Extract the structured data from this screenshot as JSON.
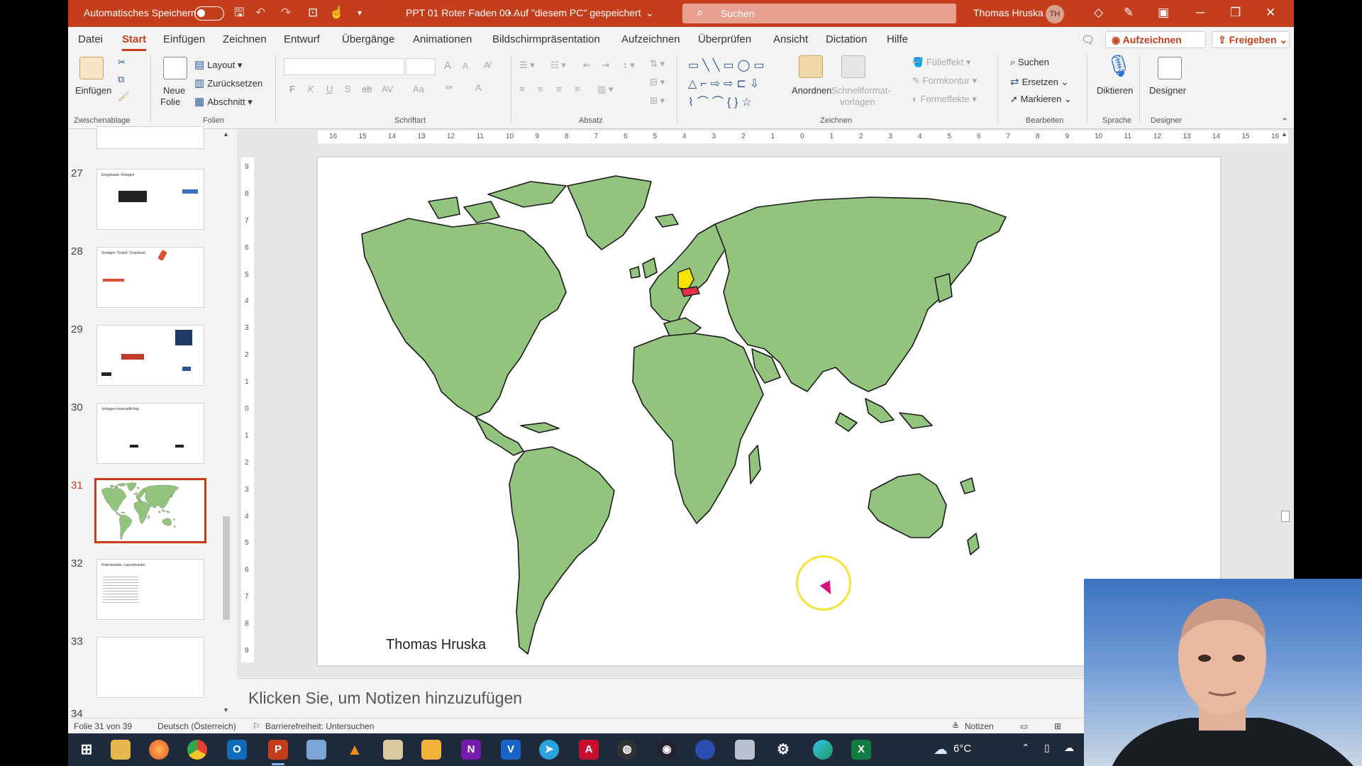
{
  "titlebar": {
    "autosave_label": "Automatisches Speichern",
    "doc_title": "PPT 01 Roter Faden 00...",
    "save_location": "• Auf \"diesem PC\" gespeichert",
    "search_placeholder": "Suchen",
    "user_name": "Thomas Hruska",
    "user_initials": "TH"
  },
  "menu": {
    "tabs": [
      "Datei",
      "Start",
      "Einfügen",
      "Zeichnen",
      "Entwurf",
      "Übergänge",
      "Animationen",
      "Bildschirmpräsentation",
      "Aufzeichnen",
      "Überprüfen",
      "Ansicht",
      "Dictation",
      "Hilfe"
    ],
    "active_tab": "Start",
    "record_label": "Aufzeichnen",
    "share_label": "Freigeben"
  },
  "ribbon": {
    "clipboard": {
      "paste": "Einfügen",
      "label": "Zwischenablage"
    },
    "slides": {
      "new_slide_1": "Neue",
      "new_slide_2": "Folie",
      "layout": "Layout",
      "reset": "Zurücksetzen",
      "section": "Abschnitt",
      "label": "Folien"
    },
    "font": {
      "label": "Schriftart",
      "bold": "F",
      "italic": "K",
      "underline": "U",
      "shadow": "S",
      "strike": "ab",
      "spacing": "AV",
      "case": "Aa",
      "grow": "A",
      "shrink": "A"
    },
    "paragraph": {
      "label": "Absatz"
    },
    "drawing": {
      "arrange": "Anordnen",
      "quickstyles_1": "Schnellformat-",
      "quickstyles_2": "vorlagen",
      "fill": "Fülleffekt",
      "outline": "Formkontur",
      "effects": "Formeffekte",
      "label": "Zeichnen"
    },
    "editing": {
      "find": "Suchen",
      "replace": "Ersetzen",
      "select": "Markieren",
      "label": "Bearbeiten"
    },
    "voice": {
      "dictate": "Diktieren",
      "label": "Sprache"
    },
    "designer": {
      "designer": "Designer",
      "label": "Designer"
    }
  },
  "thumbnails": [
    {
      "num": "27",
      "title": "Eingebaute Vorlagen"
    },
    {
      "num": "28",
      "title": "Vorlagen \"Gratis\" Download"
    },
    {
      "num": "29",
      "title": ""
    },
    {
      "num": "30",
      "title": "Vorlagen kostenpflichtig"
    },
    {
      "num": "31",
      "title": "",
      "selected": true
    },
    {
      "num": "32",
      "title": "Folienmaster, Layoutmaster"
    },
    {
      "num": "33",
      "title": ""
    },
    {
      "num": "34",
      "title": ""
    }
  ],
  "ruler": {
    "h": [
      "16",
      "15",
      "14",
      "13",
      "12",
      "11",
      "10",
      "9",
      "8",
      "7",
      "6",
      "5",
      "4",
      "3",
      "2",
      "1",
      "0",
      "1",
      "2",
      "3",
      "4",
      "5",
      "6",
      "7",
      "8",
      "9",
      "10",
      "11",
      "12",
      "13",
      "14",
      "15",
      "16"
    ],
    "v": [
      "9",
      "8",
      "7",
      "6",
      "5",
      "4",
      "3",
      "2",
      "1",
      "0",
      "1",
      "2",
      "3",
      "4",
      "5",
      "6",
      "7",
      "8",
      "9"
    ]
  },
  "slide": {
    "author": "Thomas Hruska",
    "map_land_color": "#93c47d",
    "highlight_germany": "#f9e400",
    "highlight_austria": "#e0304a"
  },
  "notes_placeholder": "Klicken Sie, um Notizen hinzuzufügen",
  "status": {
    "slide_count": "Folie 31 von 39",
    "language": "Deutsch (Österreich)",
    "accessibility": "Barrierefreiheit: Untersuchen",
    "notes_button": "Notizen"
  },
  "taskbar": {
    "apps": [
      "start",
      "explorer",
      "firefox",
      "chrome",
      "outlook",
      "powerpoint",
      "app",
      "vlc",
      "app2",
      "app3",
      "onenote",
      "visio",
      "telegram",
      "acrobat",
      "obs",
      "app4",
      "app5",
      "app6",
      "settings",
      "edge",
      "excel"
    ],
    "temperature": "6°C"
  },
  "accent_color": "#c43e1c"
}
